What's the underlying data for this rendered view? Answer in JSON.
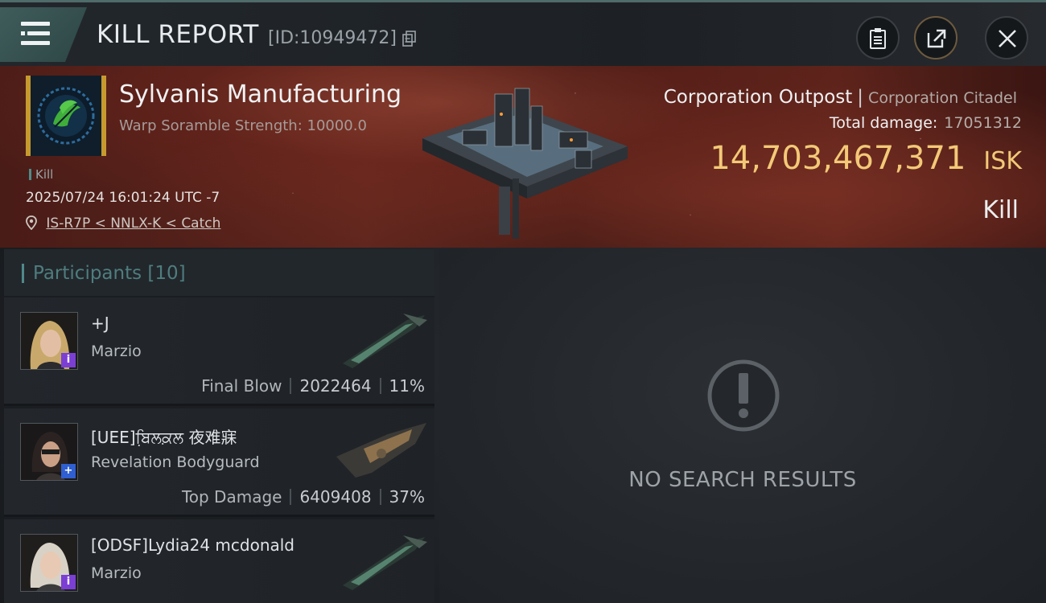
{
  "header": {
    "title": "KILL REPORT",
    "report_id": "[ID:10949472]"
  },
  "victim": {
    "name": "Sylvanis Manufacturing",
    "scramble": "Warp Soramble Strength: 10000.0",
    "kill_tag": "Kill",
    "time": "2025/07/24 16:01:24 UTC -7",
    "location": "IS-R7P < NNLX-K < Catch",
    "ship_type": "Corporation Outpost",
    "ship_subtype": "Corporation Citadel",
    "total_damage_label": "Total damage:",
    "total_damage": "17051312",
    "isk_value": "14,703,467,371",
    "isk_unit": "ISK",
    "result": "Kill"
  },
  "participants": {
    "title": "Participants",
    "count": "[10]",
    "rows": [
      {
        "name": "+J",
        "ship": "Marzio",
        "role": "Final Blow",
        "damage": "2022464",
        "pct": "11%",
        "badge": "i",
        "badge_color": "purple"
      },
      {
        "name": "[UEE]ਬਿ਼ਲਕ਼ਲ 夜难寐",
        "ship": "Revelation Bodyguard",
        "role": "Top Damage",
        "damage": "6409408",
        "pct": "37%",
        "badge": "+",
        "badge_color": "blue"
      },
      {
        "name": "[ODSF]Lydia24 mcdonald",
        "ship": "Marzio",
        "role": "",
        "damage": "",
        "pct": "",
        "badge": "i",
        "badge_color": "purple"
      }
    ]
  },
  "empty_state": {
    "message": "NO SEARCH RESULTS",
    "icon": "exclamation-icon"
  },
  "colors": {
    "accent": "#4f8a8a",
    "isk": "#f3c977",
    "corp_frame": "#c79a2f"
  }
}
